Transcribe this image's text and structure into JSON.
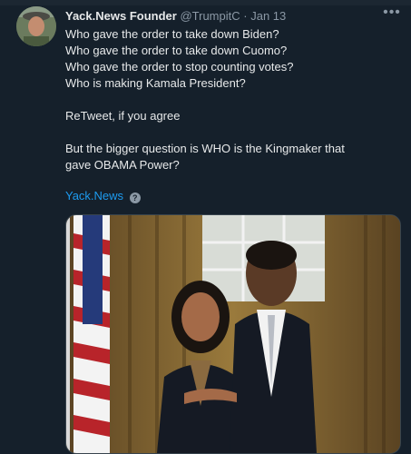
{
  "tweet": {
    "author_name": "Yack.News Founder",
    "handle": "@TrumpitC",
    "time": "Jan 13",
    "more_icon": "more-icon",
    "lines": [
      "Who gave the order to take down Biden?",
      "Who gave the order to take down Cuomo?",
      "Who gave the order to stop counting votes?",
      "Who is making Kamala President?"
    ],
    "retweet_line": "ReTweet, if you agree",
    "question_lines": [
      "But the bigger question is WHO is the Kingmaker that",
      "gave OBAMA Power?"
    ],
    "link_text": "Yack.News",
    "help_glyph": "?"
  }
}
